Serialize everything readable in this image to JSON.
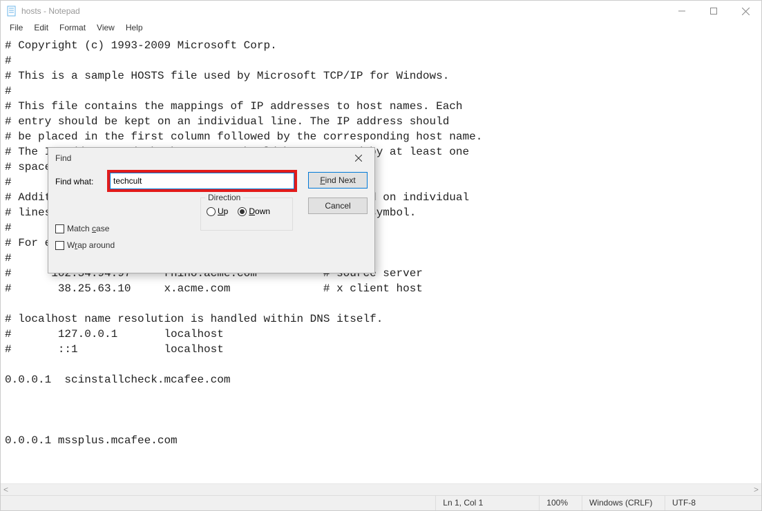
{
  "window": {
    "title": "hosts - Notepad"
  },
  "menu": {
    "file": "File",
    "edit": "Edit",
    "format": "Format",
    "view": "View",
    "help": "Help"
  },
  "document_text": "# Copyright (c) 1993-2009 Microsoft Corp.\n#\n# This is a sample HOSTS file used by Microsoft TCP/IP for Windows.\n#\n# This file contains the mappings of IP addresses to host names. Each\n# entry should be kept on an individual line. The IP address should\n# be placed in the first column followed by the corresponding host name.\n# The IP address and the host name should be separated by at least one\n# space.\n#\n# Additionally, comments (such as these) may be inserted on individual\n# lines or following the machine name denoted by a '#' symbol.\n#\n# For example:\n#\n#      102.54.94.97     rhino.acme.com          # source server\n#       38.25.63.10     x.acme.com              # x client host\n\n# localhost name resolution is handled within DNS itself.\n#       127.0.0.1       localhost\n#       ::1             localhost\n\n0.0.0.1  scinstallcheck.mcafee.com\n\n\n\n0.0.0.1 mssplus.mcafee.com\n",
  "statusbar": {
    "position": "Ln 1, Col 1",
    "zoom": "100%",
    "eol": "Windows (CRLF)",
    "encoding": "UTF-8"
  },
  "find_dialog": {
    "title": "Find",
    "find_what_label": "Find what:",
    "find_what_value": "techcult",
    "find_next": "Find Next",
    "cancel": "Cancel",
    "match_case": "Match case",
    "wrap_around": "Wrap around",
    "direction_label": "Direction",
    "up": "Up",
    "down": "Down"
  }
}
